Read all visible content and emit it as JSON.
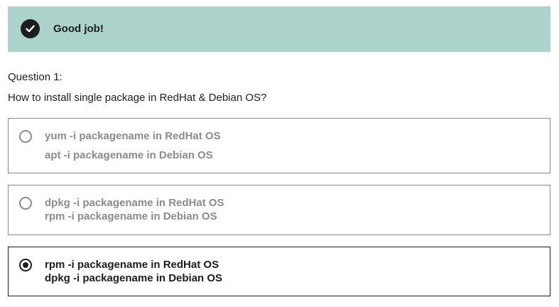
{
  "banner": {
    "icon": "check-circle-icon",
    "text": "Good job!",
    "background": "#acd2cc"
  },
  "question": {
    "number": "Question 1:",
    "text": "How to install single package in RedHat & Debian OS?"
  },
  "options": [
    {
      "line1": "yum -i packagename in RedHat OS",
      "line2": "apt -i packagename in Debian OS",
      "selected": false
    },
    {
      "line1": "dpkg -i packagename in RedHat OS",
      "line2": "rpm -i packagename in Debian OS",
      "selected": false
    },
    {
      "line1": "rpm -i packagename in RedHat OS",
      "line2": "dpkg -i packagename in Debian OS",
      "selected": true
    }
  ],
  "colors": {
    "text": "#1c1d1f",
    "muted": "#8a8b8c",
    "success": "#acd2cc"
  }
}
